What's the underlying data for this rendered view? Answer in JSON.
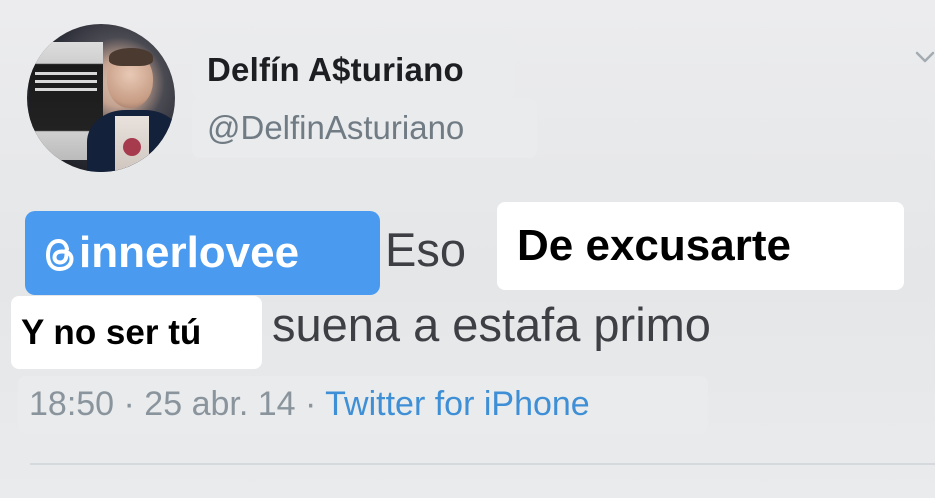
{
  "tweet": {
    "author": {
      "display_name": "Delfín A$turiano",
      "handle": "@DelfinAsturiano"
    },
    "mention": "innerlovee",
    "text_line1": "Eso",
    "text_line2": "suena a estafa primo",
    "timestamp": "18:50 · 25 abr. 14 ·",
    "source": "Twitter for iPhone"
  },
  "overlays": {
    "caption_1": "De excusarte",
    "caption_2": "Y no ser tú"
  },
  "colors": {
    "mention_bg": "#4a9bf0",
    "source_link": "#3f8fd6",
    "background": "#e6e8ea"
  },
  "icons": {
    "mention_icon": "threads-icon",
    "menu_icon": "chevron-down-icon"
  }
}
